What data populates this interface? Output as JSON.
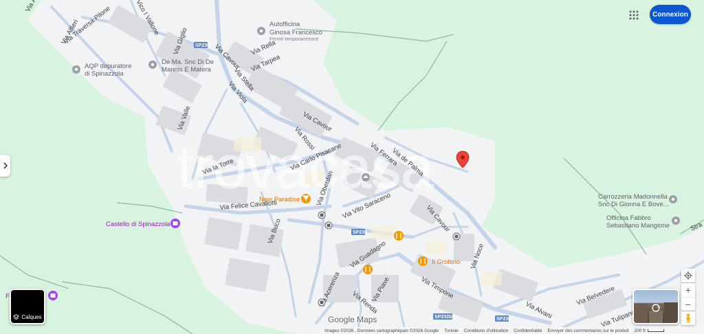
{
  "map": {
    "watermark": "trovacasa",
    "streets": {
      "via_traversa_pilone": "Via Traversa Pilone",
      "via_alfieri": "Via Alfieri",
      "via_alfieri_2": "Via Alfieri",
      "vico_vallone": "Vico I Vallone",
      "via_giglio": "Via Giglio",
      "via_cavour_top": "Via Cavour",
      "via_rella": "Via Rella",
      "via_tarpea": "Via Tarpea",
      "via_stella": "Via Stella",
      "via_viola": "Via Viola",
      "via_valle": "Via Valle",
      "via_cavour_mid": "Via Cavour",
      "via_rossi": "Via Rossi",
      "via_carlo_pisacane": "Via Carlo Pisacane",
      "via_ferrara": "Via Ferrara",
      "via_de_palma": "Via de Palma",
      "via_la_torre": "Via la Torre",
      "via_oberdan": "Via Oberdan",
      "via_felice_cavallotti": "Via Felice Cavallotti",
      "via_vito_saraceno": "Via Vito Saraceno",
      "via_cavour_bottom": "Via Cavour",
      "via_buco": "Via Buco",
      "via_guadagno": "Via Guadagno",
      "via_noce": "Via Noce",
      "via_acerenza": "Via Acerenza",
      "via_renda": "Via Renda",
      "via_piave": "Via Piave",
      "via_timpone": "Via Timpone",
      "via_alvani": "Via Alvani",
      "via_belvedere": "Via Belvedere",
      "via_tulipano": "Via Tulipano",
      "via_str": "Stra"
    },
    "road_shields": {
      "sp230_top": "SP230",
      "sp230_mid": "SP230",
      "sp230_bottom": "SP230",
      "sp232bis": "SP232bis"
    },
    "pois": {
      "autofficina_line1": "Autofficina",
      "autofficina_line2": "Ginosa Francesco",
      "autofficina_status": "Fermé temporairement",
      "aqp_line1": "AQP depuratore",
      "aqp_line2": "di Spinazzola",
      "dema_line1": "De Ma. Snc Di De",
      "dema_line2": "Marinis E Matera",
      "new_paradise": "New Paradise",
      "castello": "Castello di Spinazzola",
      "il_grottino": "Il Grottino",
      "carrozzeria_line1": "Carrozzeria Madonnella",
      "carrozzeria_line2": "Snc Di Gionna E Bove...",
      "officina_line1": "Officina Fabbro",
      "officina_line2": "Sebastiano Mangione",
      "partial_left": "F"
    }
  },
  "controls": {
    "signin_label": "Connexion",
    "layers_label": "Calques",
    "zoom_in": "+",
    "zoom_out": "−"
  },
  "branding": {
    "google_maps": "Google Maps"
  },
  "footer": {
    "imagery": "Images ©2026 , Données cartographiques ©2026 Google",
    "country": "Tunisie",
    "terms": "Conditions d'utilisation",
    "privacy": "Confidentialité",
    "feedback": "Envoyer des commentaires sur le produit",
    "scale": "200 ft"
  },
  "colors": {
    "park_green": "#d8f3e0",
    "urban_gray": "#f1f3f4",
    "block_gray": "#dadce0",
    "road_blue": "#c5d4e8",
    "pin_red": "#ea4335",
    "signin_blue": "#0b57d0",
    "poi_purple": "#8e24aa",
    "poi_orange": "#e37400"
  },
  "icons": {
    "apps": "apps-grid-icon",
    "layers": "layers-icon",
    "locate": "my-location-icon",
    "pegman": "pegman-icon",
    "pin": "map-pin-icon"
  }
}
